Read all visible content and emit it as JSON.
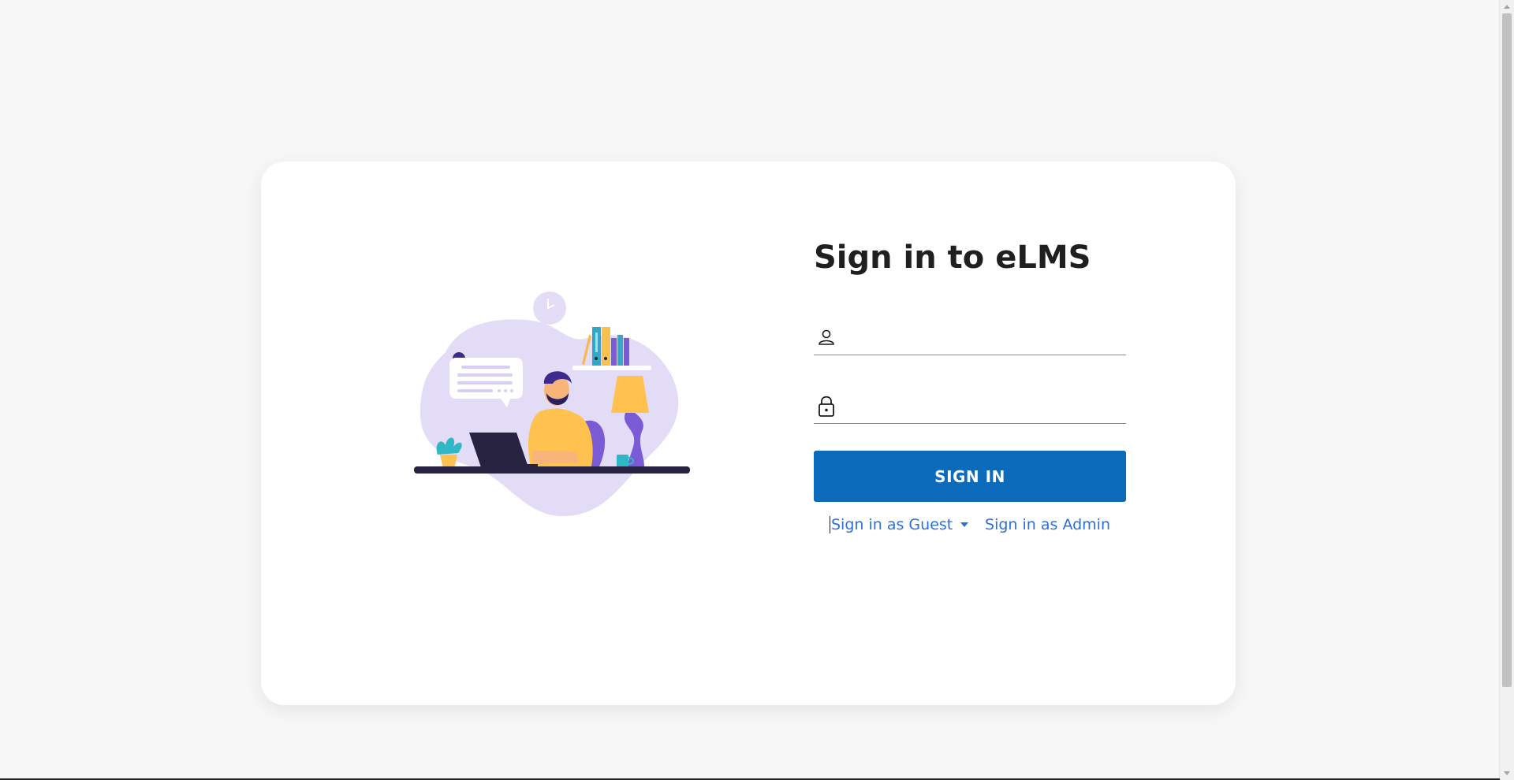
{
  "login": {
    "title": "Sign in to eLMS",
    "username": {
      "value": "",
      "placeholder": "",
      "icon": "user-icon"
    },
    "password": {
      "value": "",
      "placeholder": "",
      "icon": "lock-icon"
    },
    "signin_label": "SIGN IN",
    "guest_label": "Sign in as Guest",
    "admin_label": "Sign in as Admin"
  },
  "colors": {
    "page_bg": "#f7f7f7",
    "card_bg": "#ffffff",
    "primary": "#0b6bba",
    "link": "#2d6fd9",
    "title": "#1f1f1f",
    "illustration_blob": "#e3dcf6"
  }
}
